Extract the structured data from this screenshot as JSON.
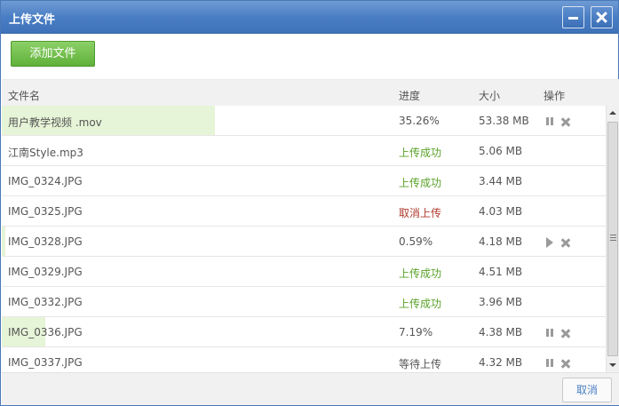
{
  "dialog": {
    "title": "上传文件"
  },
  "toolbar": {
    "add_label": "添加文件"
  },
  "columns": {
    "name": "文件名",
    "progress": "进度",
    "size": "大小",
    "ops": "操作"
  },
  "colors": {
    "success": "#5aa229",
    "cancel": "#b03a2e",
    "progress_fill": "#e6f4d7",
    "accent": "#4a7ec4"
  },
  "files": [
    {
      "name": "用户教学视频 .mov",
      "status": "35.26%",
      "status_type": "normal",
      "size": "53.38 MB",
      "progress": 0.3526,
      "actions": [
        "pause-icon",
        "remove-icon"
      ]
    },
    {
      "name": "江南Style.mp3",
      "status": "上传成功",
      "status_type": "success",
      "size": "5.06 MB",
      "progress": 0,
      "actions": []
    },
    {
      "name": "IMG_0324.JPG",
      "status": "上传成功",
      "status_type": "success",
      "size": "3.44 MB",
      "progress": 0,
      "actions": []
    },
    {
      "name": "IMG_0325.JPG",
      "status": "取消上传",
      "status_type": "cancel",
      "size": "4.03 MB",
      "progress": 0,
      "actions": []
    },
    {
      "name": "IMG_0328.JPG",
      "status": "0.59%",
      "status_type": "normal",
      "size": "4.18 MB",
      "progress": 0.0059,
      "actions": [
        "play-icon",
        "remove-icon"
      ]
    },
    {
      "name": "IMG_0329.JPG",
      "status": "上传成功",
      "status_type": "success",
      "size": "4.51 MB",
      "progress": 0,
      "actions": []
    },
    {
      "name": "IMG_0332.JPG",
      "status": "上传成功",
      "status_type": "success",
      "size": "3.96 MB",
      "progress": 0,
      "actions": []
    },
    {
      "name": "IMG_0336.JPG",
      "status": "7.19%",
      "status_type": "normal",
      "size": "4.38 MB",
      "progress": 0.0719,
      "actions": [
        "pause-icon",
        "remove-icon"
      ]
    },
    {
      "name": "IMG_0337.JPG",
      "status": "等待上传",
      "status_type": "normal",
      "size": "4.32 MB",
      "progress": 0,
      "actions": [
        "pause-icon",
        "remove-icon"
      ]
    }
  ],
  "footer": {
    "cancel_label": "取消"
  }
}
